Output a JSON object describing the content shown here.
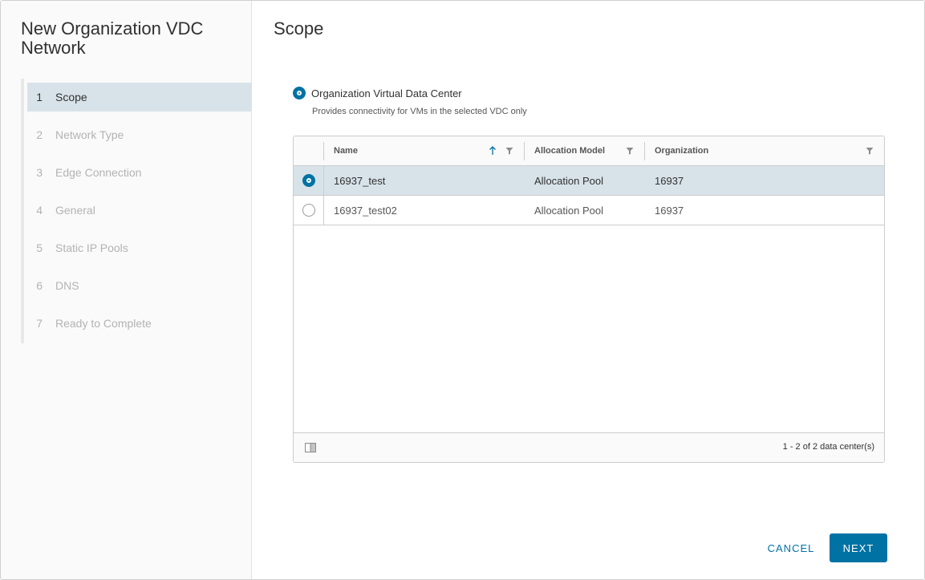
{
  "wizard": {
    "title": "New Organization VDC Network",
    "steps": [
      {
        "num": "1",
        "label": "Scope",
        "active": true
      },
      {
        "num": "2",
        "label": "Network Type",
        "active": false
      },
      {
        "num": "3",
        "label": "Edge Connection",
        "active": false
      },
      {
        "num": "4",
        "label": "General",
        "active": false
      },
      {
        "num": "5",
        "label": "Static IP Pools",
        "active": false
      },
      {
        "num": "6",
        "label": "DNS",
        "active": false
      },
      {
        "num": "7",
        "label": "Ready to Complete",
        "active": false
      }
    ]
  },
  "main": {
    "title": "Scope",
    "scope_option": {
      "label": "Organization Virtual Data Center",
      "description": "Provides connectivity for VMs in the selected VDC only",
      "selected": true
    },
    "grid": {
      "columns": {
        "name": "Name",
        "allocation": "Allocation Model",
        "organization": "Organization"
      },
      "rows": [
        {
          "name": "16937_test",
          "allocation": "Allocation Pool",
          "organization": "16937",
          "selected": true
        },
        {
          "name": "16937_test02",
          "allocation": "Allocation Pool",
          "organization": "16937",
          "selected": false
        }
      ],
      "footer_count": "1 - 2 of 2 data center(s)"
    }
  },
  "buttons": {
    "cancel": "CANCEL",
    "next": "NEXT"
  },
  "colors": {
    "accent": "#0072a3",
    "selected_row": "#d8e3e9"
  },
  "icons": {
    "sort": "arrow-up-icon",
    "filter": "filter-icon",
    "column_toggle": "column-toggle-icon"
  }
}
